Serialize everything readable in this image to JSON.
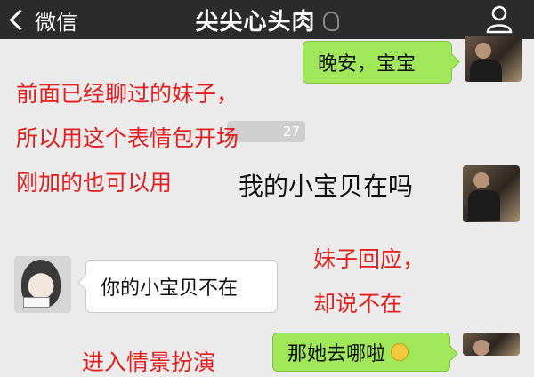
{
  "header": {
    "back_label": "微信",
    "title": "尖尖心头肉",
    "icons": {
      "back": "chevron-left-icon",
      "earpiece": "ear-icon",
      "profile": "profile-icon"
    }
  },
  "messages": [
    {
      "side": "right",
      "text": "晚安，宝宝",
      "bubble_color": "#a0e759",
      "avatar": "man-avatar"
    },
    {
      "side": "right",
      "text": "我的小宝贝在吗",
      "avatar": "man-avatar"
    },
    {
      "side": "left",
      "text": "你的小宝贝不在",
      "bubble_color": "#ffffff",
      "avatar": "woman-avatar"
    },
    {
      "side": "right",
      "text": "那她去哪啦",
      "bubble_color": "#a0e759",
      "avatar": "man-avatar"
    }
  ],
  "timestamp_fragment": "27",
  "annotations": {
    "line1": "前面已经聊过的妹子，",
    "line2": "所以用这个表情包开场",
    "line3": "刚加的也可以用",
    "reply1": "妹子回应，",
    "reply2": "却说不在",
    "bottom": "进入情景扮演"
  },
  "colors": {
    "annotation": "#e02020",
    "topbar": "#2b2b2b",
    "chat_bg": "#ebebeb"
  }
}
